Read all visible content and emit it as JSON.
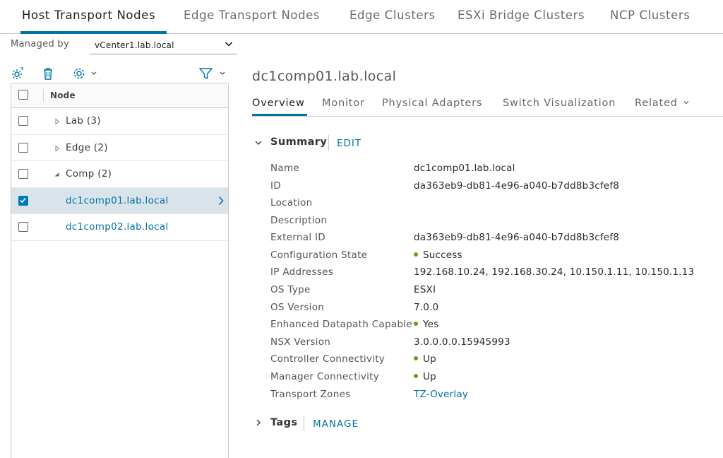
{
  "top_tabs": [
    {
      "label": "Host Transport Nodes",
      "active": true
    },
    {
      "label": "Edge Transport Nodes",
      "active": false
    },
    {
      "label": "Edge Clusters",
      "active": false
    },
    {
      "label": "ESXi Bridge Clusters",
      "active": false
    },
    {
      "label": "NCP Clusters",
      "active": false
    }
  ],
  "managed_by": {
    "label": "Managed by",
    "value": "vCenter1.lab.local"
  },
  "toolbar": {
    "icons": [
      "configure-gear-icon",
      "trash-icon",
      "settings-gear-icon",
      "filter-icon"
    ]
  },
  "tree": {
    "header": "Node",
    "rows": [
      {
        "label": "Lab (3)",
        "expanded": false,
        "checked": false,
        "selected": false
      },
      {
        "label": "Edge (2)",
        "expanded": false,
        "checked": false,
        "selected": false
      },
      {
        "label": "Comp (2)",
        "expanded": true,
        "checked": false,
        "selected": false
      },
      {
        "label": "dc1comp01.lab.local",
        "checked": true,
        "selected": true
      },
      {
        "label": "dc1comp02.lab.local",
        "checked": false,
        "selected": false
      }
    ]
  },
  "detail": {
    "title": "dc1comp01.lab.local",
    "tabs": [
      {
        "label": "Overview",
        "active": true
      },
      {
        "label": "Monitor",
        "active": false
      },
      {
        "label": "Physical Adapters",
        "active": false
      },
      {
        "label": "Switch Visualization",
        "active": false
      },
      {
        "label": "Related",
        "active": false
      }
    ],
    "summary": {
      "label": "Summary",
      "action": "EDIT",
      "properties": [
        {
          "label": "Name",
          "value": "dc1comp01.lab.local"
        },
        {
          "label": "ID",
          "value": "da363eb9-db81-4e96-a040-b7dd8b3cfef8"
        },
        {
          "label": "Location",
          "value": ""
        },
        {
          "label": "Description",
          "value": ""
        },
        {
          "label": "External ID",
          "value": "da363eb9-db81-4e96-a040-b7dd8b3cfef8"
        },
        {
          "label": "Configuration State",
          "value": "Success",
          "status": "green"
        },
        {
          "label": "IP Addresses",
          "value": "192.168.10.24, 192.168.30.24, 10.150.1.11, 10.150.1.13"
        },
        {
          "label": "OS Type",
          "value": "ESXI"
        },
        {
          "label": "OS Version",
          "value": "7.0.0"
        },
        {
          "label": "Enhanced Datapath Capable",
          "value": "Yes",
          "status": "green"
        },
        {
          "label": "NSX Version",
          "value": "3.0.0.0.0.15945993"
        },
        {
          "label": "Controller Connectivity",
          "value": "Up",
          "status": "green"
        },
        {
          "label": "Manager Connectivity",
          "value": "Up",
          "status": "green"
        },
        {
          "label": "Transport Zones",
          "value": "TZ-Overlay",
          "link": true
        }
      ]
    },
    "tags": {
      "label": "Tags",
      "action": "MANAGE"
    }
  },
  "colors": {
    "accent": "#0072a3",
    "status_green": "#5aa220",
    "selected_row": "#d9e4ea"
  }
}
